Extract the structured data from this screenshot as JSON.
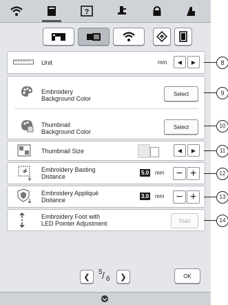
{
  "topbar": {
    "tabs": [
      {
        "icon": "wifi-icon"
      },
      {
        "icon": "page-icon"
      },
      {
        "icon": "help-icon",
        "label": "?"
      },
      {
        "icon": "presser-foot-icon"
      },
      {
        "icon": "lock-icon"
      },
      {
        "icon": "needle-mode-icon"
      }
    ]
  },
  "subbar": {
    "buttons": [
      {
        "icon": "sewing-machine-icon"
      },
      {
        "icon": "embroidery-machine-icon"
      },
      {
        "icon": "wifi-icon"
      },
      {
        "icon": "diamond-arrow-icon"
      },
      {
        "icon": "frame-icon"
      }
    ]
  },
  "settings": {
    "unit": {
      "label": "Unit",
      "value": "mm",
      "callout": "8"
    },
    "bg_color": {
      "label_line1": "Embroidery",
      "label_line2": "Background Color",
      "button": "Select",
      "callout": "9"
    },
    "thumb_color": {
      "label_line1": "Thumbnail",
      "label_line2": "Background Color",
      "button": "Select",
      "callout": "10"
    },
    "thumb_size": {
      "label": "Thumbnail Size",
      "callout": "11"
    },
    "basting": {
      "label_line1": "Embroidery Basting",
      "label_line2": "Distance",
      "value": "5.0",
      "unit": "mm",
      "minus": "−",
      "plus": "+",
      "callout": "12"
    },
    "applique": {
      "label_line1": "Embroidery Appliqué",
      "label_line2": "Distance",
      "value": "3.0",
      "unit": "mm",
      "minus": "−",
      "plus": "+",
      "callout": "13"
    },
    "led": {
      "label_line1": "Embroidery Foot with",
      "label_line2": "LED Pointer Adjustment",
      "button": "Start",
      "callout": "14"
    }
  },
  "pager": {
    "current": "5",
    "total": "6",
    "ok": "OK"
  },
  "colors": {
    "screen_bg": "#e4e6ea",
    "toolbar_bg": "#cfd2d7",
    "value_box": "#1e1e1e"
  }
}
